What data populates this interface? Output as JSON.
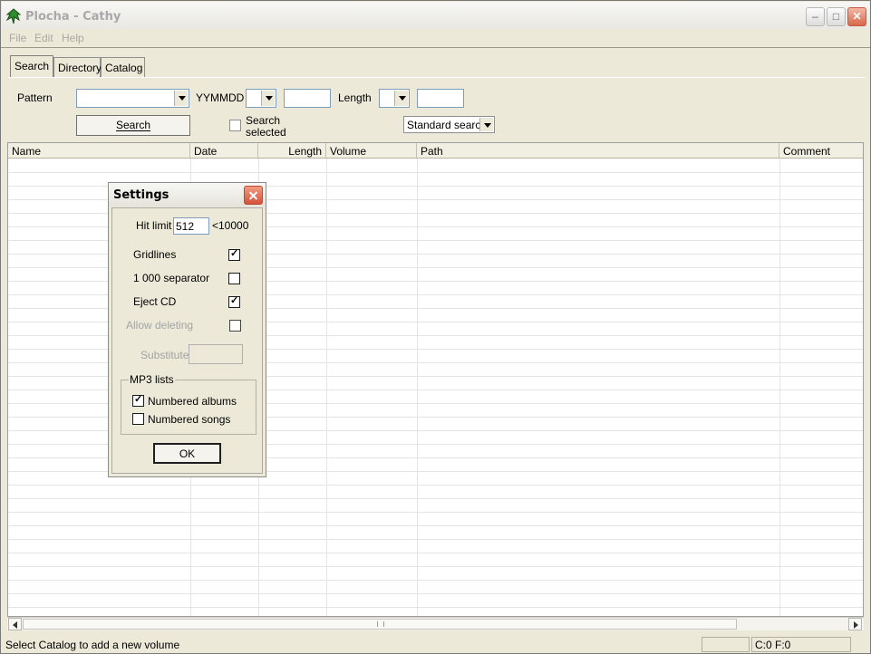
{
  "window": {
    "title": "Plocha - Cathy"
  },
  "menu": [
    "File",
    "Edit",
    "Help"
  ],
  "tabs": [
    "Search",
    "Directory",
    "Catalog"
  ],
  "search": {
    "pattern_label": "Pattern",
    "pattern_value": "",
    "date_label": "YYMMDD",
    "date_value": "",
    "length_label": "Length",
    "length_value": "",
    "search_button": "Search",
    "search_selected_label_1": "Search",
    "search_selected_label_2": "selected",
    "search_mode": "Standard search"
  },
  "columns": [
    "Name",
    "Date",
    "Length",
    "Volume",
    "Path",
    "Comment"
  ],
  "statusbar": {
    "message": "Select Catalog to add a new volume",
    "counts": "C:0 F:0"
  },
  "dialog": {
    "title": "Settings",
    "hit_limit_label": "Hit limit",
    "hit_limit_value": "512",
    "hit_limit_note": "<10000",
    "gridlines_label": "Gridlines",
    "gridlines_checked": true,
    "separator_label": "1 000 separator",
    "separator_checked": false,
    "eject_label": "Eject CD",
    "eject_checked": true,
    "allow_deleting_label": "Allow deleting",
    "allow_deleting_checked": false,
    "substitutes_label": "Substitutes",
    "substitutes_value": "",
    "mp3_group_label": "MP3 lists",
    "numbered_albums_label": "Numbered albums",
    "numbered_albums_checked": true,
    "numbered_songs_label": "Numbered songs",
    "numbered_songs_checked": false,
    "ok_button": "OK"
  },
  "colors": {
    "window_bg": "#ece9d8",
    "close_red": "#d4523a"
  }
}
